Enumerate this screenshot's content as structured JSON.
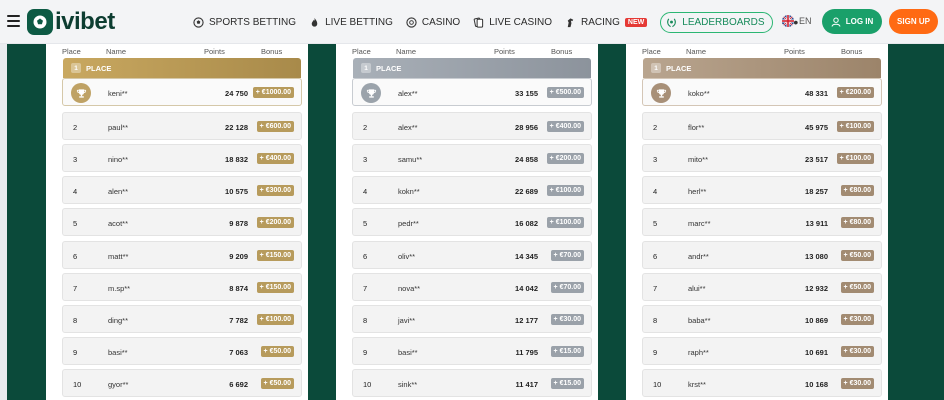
{
  "header": {
    "logo_text": "ivibet",
    "nav": [
      {
        "label": "SPORTS BETTING",
        "icon": "soccer-ball-icon"
      },
      {
        "label": "LIVE BETTING",
        "icon": "flame-icon"
      },
      {
        "label": "CASINO",
        "icon": "chip-icon"
      },
      {
        "label": "LIVE CASINO",
        "icon": "cards-icon"
      },
      {
        "label": "RACING",
        "icon": "horse-icon",
        "badge": "NEW"
      },
      {
        "label": "LEADERBOARDS",
        "icon": "laurel-icon"
      }
    ],
    "more": "•••",
    "language": "EN",
    "login_label": "LOG IN",
    "signup_label": "SIGN UP"
  },
  "columns": {
    "place": "Place",
    "name": "Name",
    "points": "Points",
    "bonus": "Bonus"
  },
  "colors": {
    "gold": "#b79b5c",
    "silver": "#9aa1a9",
    "bronze": "#a28b72",
    "login": "#1aa06a",
    "signup": "#ff6a13"
  },
  "leaderboards": [
    {
      "tier": "gold",
      "banner_num": "1",
      "banner_label": "PLACE",
      "rows": [
        {
          "rank": "1",
          "name": "keni**",
          "points": "24 750",
          "bonus": "+ €1000.00"
        },
        {
          "rank": "2",
          "name": "paul**",
          "points": "22 128",
          "bonus": "+ €600.00"
        },
        {
          "rank": "3",
          "name": "nino**",
          "points": "18 832",
          "bonus": "+ €400.00"
        },
        {
          "rank": "4",
          "name": "alen**",
          "points": "10 575",
          "bonus": "+ €300.00"
        },
        {
          "rank": "5",
          "name": "acot**",
          "points": "9 878",
          "bonus": "+ €200.00"
        },
        {
          "rank": "6",
          "name": "matt**",
          "points": "9 209",
          "bonus": "+ €150.00"
        },
        {
          "rank": "7",
          "name": "m.sp**",
          "points": "8 874",
          "bonus": "+ €150.00"
        },
        {
          "rank": "8",
          "name": "ding**",
          "points": "7 782",
          "bonus": "+ €100.00"
        },
        {
          "rank": "9",
          "name": "basi**",
          "points": "7 063",
          "bonus": "+ €50.00"
        },
        {
          "rank": "10",
          "name": "gyor**",
          "points": "6 692",
          "bonus": "+ €50.00"
        }
      ]
    },
    {
      "tier": "silver",
      "banner_num": "1",
      "banner_label": "PLACE",
      "rows": [
        {
          "rank": "1",
          "name": "alex**",
          "points": "33 155",
          "bonus": "+ €500.00"
        },
        {
          "rank": "2",
          "name": "alex**",
          "points": "28 956",
          "bonus": "+ €400.00"
        },
        {
          "rank": "3",
          "name": "samu**",
          "points": "24 858",
          "bonus": "+ €200.00"
        },
        {
          "rank": "4",
          "name": "kokn**",
          "points": "22 689",
          "bonus": "+ €100.00"
        },
        {
          "rank": "5",
          "name": "pedr**",
          "points": "16 082",
          "bonus": "+ €100.00"
        },
        {
          "rank": "6",
          "name": "oliv**",
          "points": "14 345",
          "bonus": "+ €70.00"
        },
        {
          "rank": "7",
          "name": "nova**",
          "points": "14 042",
          "bonus": "+ €70.00"
        },
        {
          "rank": "8",
          "name": "javi**",
          "points": "12 177",
          "bonus": "+ €30.00"
        },
        {
          "rank": "9",
          "name": "basi**",
          "points": "11 795",
          "bonus": "+ €15.00"
        },
        {
          "rank": "10",
          "name": "sink**",
          "points": "11 417",
          "bonus": "+ €15.00"
        }
      ]
    },
    {
      "tier": "bronze",
      "banner_num": "1",
      "banner_label": "PLACE",
      "rows": [
        {
          "rank": "1",
          "name": "koko**",
          "points": "48 331",
          "bonus": "+ €200.00"
        },
        {
          "rank": "2",
          "name": "flor**",
          "points": "45 975",
          "bonus": "+ €100.00"
        },
        {
          "rank": "3",
          "name": "mito**",
          "points": "23 517",
          "bonus": "+ €100.00"
        },
        {
          "rank": "4",
          "name": "herl**",
          "points": "18 257",
          "bonus": "+ €80.00"
        },
        {
          "rank": "5",
          "name": "marc**",
          "points": "13 911",
          "bonus": "+ €80.00"
        },
        {
          "rank": "6",
          "name": "andr**",
          "points": "13 080",
          "bonus": "+ €50.00"
        },
        {
          "rank": "7",
          "name": "alui**",
          "points": "12 932",
          "bonus": "+ €50.00"
        },
        {
          "rank": "8",
          "name": "baba**",
          "points": "10 869",
          "bonus": "+ €30.00"
        },
        {
          "rank": "9",
          "name": "raph**",
          "points": "10 691",
          "bonus": "+ €30.00"
        },
        {
          "rank": "10",
          "name": "krst**",
          "points": "10 168",
          "bonus": "+ €30.00"
        }
      ]
    }
  ]
}
